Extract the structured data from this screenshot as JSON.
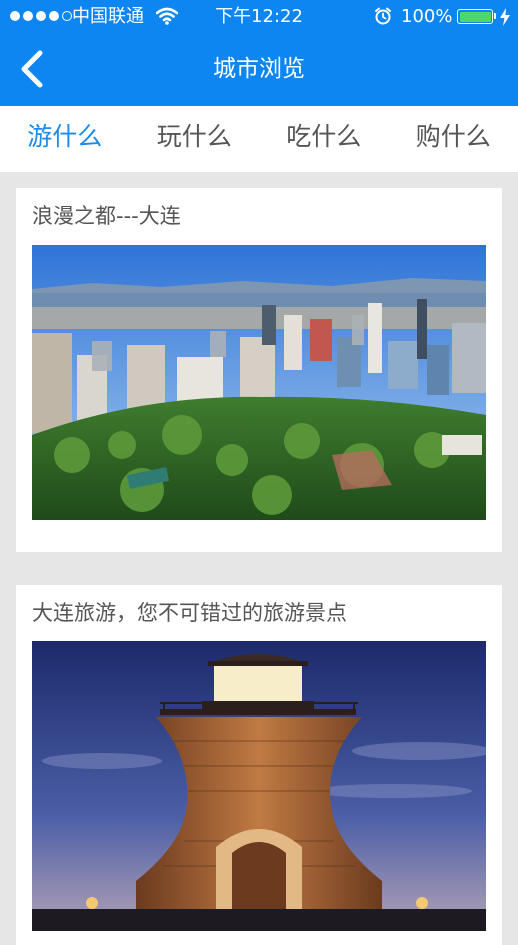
{
  "status_bar": {
    "carrier": "中国联通",
    "time": "下午12:22",
    "battery_percent": "100%",
    "icons": [
      "signal-dots",
      "wifi-icon",
      "alarm-clock-icon",
      "battery-icon",
      "charging-bolt-icon"
    ]
  },
  "nav": {
    "title": "城市浏览",
    "back_icon": "chevron-left-icon"
  },
  "tabs": [
    {
      "label": "游什么",
      "active": true
    },
    {
      "label": "玩什么",
      "active": false
    },
    {
      "label": "吃什么",
      "active": false
    },
    {
      "label": "购什么",
      "active": false
    }
  ],
  "articles": [
    {
      "title": "浪漫之都---大连",
      "image": "dalian-city-skyline-photo"
    },
    {
      "title": "大连旅游，您不可错过的旅游景点",
      "image": "lighthouse-at-dusk-photo"
    }
  ],
  "colors": {
    "header_bg": "#0d86f2",
    "active_tab": "#1a8cf0",
    "page_bg": "#e6e6e6"
  }
}
